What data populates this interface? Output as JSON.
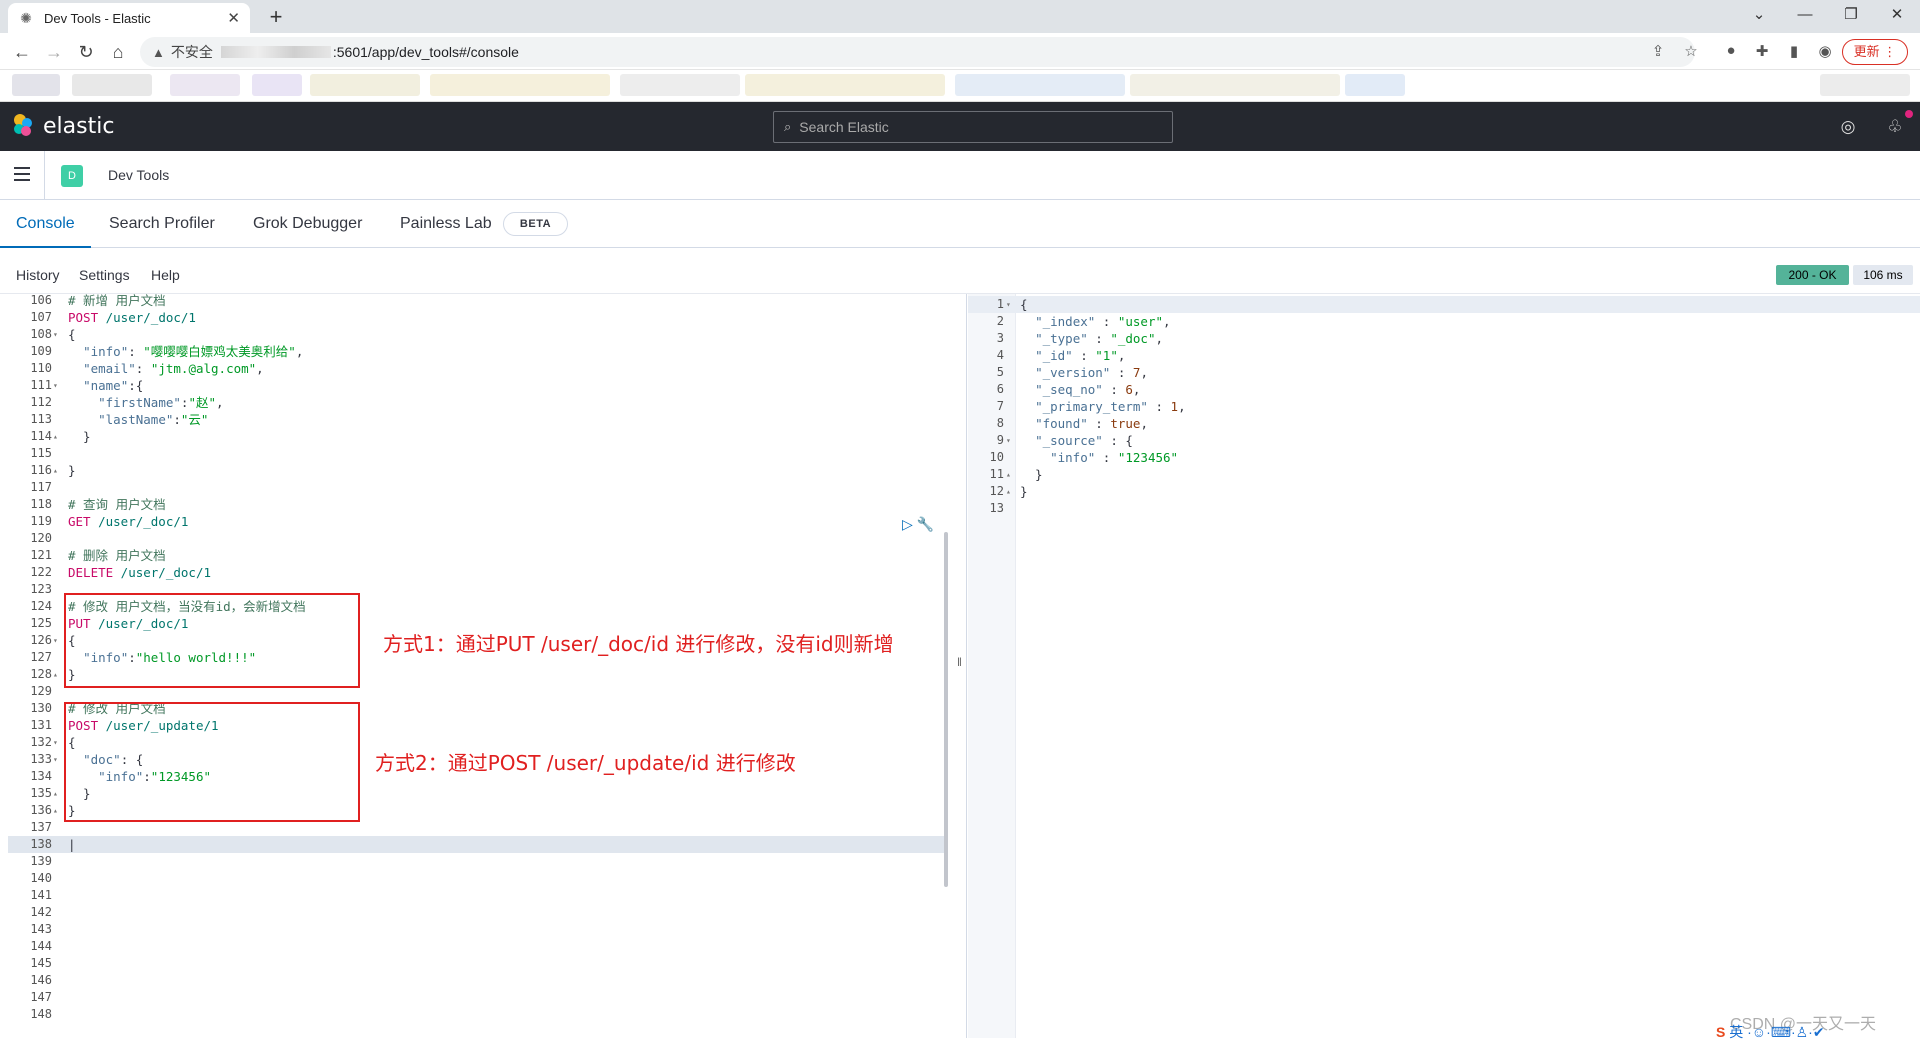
{
  "browser": {
    "tab_title": "Dev Tools - Elastic",
    "insecure_label": "不安全",
    "url_rest": ":5601/app/dev_tools#/console",
    "update_label": "更新"
  },
  "kibana": {
    "brand": "elastic",
    "search_placeholder": "Search Elastic",
    "avatar_letter": "D",
    "breadcrumb": "Dev Tools",
    "tabs": [
      "Console",
      "Search Profiler",
      "Grok Debugger",
      "Painless Lab"
    ],
    "beta_badge": "BETA",
    "menu": [
      "History",
      "Settings",
      "Help"
    ],
    "status": "200 - OK",
    "duration": "106 ms"
  },
  "editor_lines": [
    {
      "n": "106",
      "f": "",
      "t": [
        [
          "c-cm",
          "# 新增 用户文档"
        ]
      ]
    },
    {
      "n": "107",
      "f": "",
      "t": [
        [
          "c-m",
          "POST"
        ],
        [
          "c-u",
          " /user/_doc/1"
        ]
      ]
    },
    {
      "n": "108",
      "f": "▾",
      "t": [
        [
          "c-p",
          "{"
        ]
      ]
    },
    {
      "n": "109",
      "f": "",
      "t": [
        [
          "c-p",
          "  "
        ],
        [
          "c-k",
          "\"info\""
        ],
        [
          "c-p",
          ": "
        ],
        [
          "c-s",
          "\"嘤嘤嘤白嫖鸡太美奥利给\""
        ],
        [
          "c-p",
          ","
        ]
      ]
    },
    {
      "n": "110",
      "f": "",
      "t": [
        [
          "c-p",
          "  "
        ],
        [
          "c-k",
          "\"email\""
        ],
        [
          "c-p",
          ": "
        ],
        [
          "c-s",
          "\"jtm.@alg.com\""
        ],
        [
          "c-p",
          ","
        ]
      ]
    },
    {
      "n": "111",
      "f": "▾",
      "t": [
        [
          "c-p",
          "  "
        ],
        [
          "c-k",
          "\"name\""
        ],
        [
          "c-p",
          ":{"
        ]
      ]
    },
    {
      "n": "112",
      "f": "",
      "t": [
        [
          "c-p",
          "    "
        ],
        [
          "c-k",
          "\"firstName\""
        ],
        [
          "c-p",
          ":"
        ],
        [
          "c-s",
          "\"赵\""
        ],
        [
          "c-p",
          ","
        ]
      ]
    },
    {
      "n": "113",
      "f": "",
      "t": [
        [
          "c-p",
          "    "
        ],
        [
          "c-k",
          "\"lastName\""
        ],
        [
          "c-p",
          ":"
        ],
        [
          "c-s",
          "\"云\""
        ]
      ]
    },
    {
      "n": "114",
      "f": "▴",
      "t": [
        [
          "c-p",
          "  }"
        ]
      ]
    },
    {
      "n": "115",
      "f": "",
      "t": []
    },
    {
      "n": "116",
      "f": "▴",
      "t": [
        [
          "c-p",
          "}"
        ]
      ]
    },
    {
      "n": "117",
      "f": "",
      "t": []
    },
    {
      "n": "118",
      "f": "",
      "t": [
        [
          "c-cm",
          "# 查询 用户文档"
        ]
      ]
    },
    {
      "n": "119",
      "f": "",
      "t": [
        [
          "c-m",
          "GET"
        ],
        [
          "c-u",
          " /user/_doc/1"
        ]
      ]
    },
    {
      "n": "120",
      "f": "",
      "t": []
    },
    {
      "n": "121",
      "f": "",
      "t": [
        [
          "c-cm",
          "# 删除 用户文档"
        ]
      ]
    },
    {
      "n": "122",
      "f": "",
      "t": [
        [
          "c-m",
          "DELETE"
        ],
        [
          "c-u",
          " /user/_doc/1"
        ]
      ]
    },
    {
      "n": "123",
      "f": "",
      "t": []
    },
    {
      "n": "124",
      "f": "",
      "t": [
        [
          "c-cm",
          "# 修改 用户文档，当没有id，会新增文档"
        ]
      ]
    },
    {
      "n": "125",
      "f": "",
      "t": [
        [
          "c-m",
          "PUT"
        ],
        [
          "c-u",
          " /user/_doc/1"
        ]
      ]
    },
    {
      "n": "126",
      "f": "▾",
      "t": [
        [
          "c-p",
          "{"
        ]
      ]
    },
    {
      "n": "127",
      "f": "",
      "t": [
        [
          "c-p",
          "  "
        ],
        [
          "c-k",
          "\"info\""
        ],
        [
          "c-p",
          ":"
        ],
        [
          "c-s",
          "\"hello world!!!\""
        ]
      ]
    },
    {
      "n": "128",
      "f": "▴",
      "t": [
        [
          "c-p",
          "}"
        ]
      ]
    },
    {
      "n": "129",
      "f": "",
      "t": []
    },
    {
      "n": "130",
      "f": "",
      "t": [
        [
          "c-cm",
          "# 修改 用户文档"
        ]
      ]
    },
    {
      "n": "131",
      "f": "",
      "t": [
        [
          "c-m",
          "POST"
        ],
        [
          "c-u",
          " /user/_update/1"
        ]
      ]
    },
    {
      "n": "132",
      "f": "▾",
      "t": [
        [
          "c-p",
          "{"
        ]
      ]
    },
    {
      "n": "133",
      "f": "▾",
      "t": [
        [
          "c-p",
          "  "
        ],
        [
          "c-k",
          "\"doc\""
        ],
        [
          "c-p",
          ": {"
        ]
      ]
    },
    {
      "n": "134",
      "f": "",
      "t": [
        [
          "c-p",
          "    "
        ],
        [
          "c-k",
          "\"info\""
        ],
        [
          "c-p",
          ":"
        ],
        [
          "c-s",
          "\"123456\""
        ]
      ]
    },
    {
      "n": "135",
      "f": "▴",
      "t": [
        [
          "c-p",
          "  }"
        ]
      ]
    },
    {
      "n": "136",
      "f": "▴",
      "t": [
        [
          "c-p",
          "}"
        ]
      ]
    },
    {
      "n": "137",
      "f": "",
      "t": []
    },
    {
      "n": "138",
      "f": "",
      "t": [
        [
          "c-p",
          "|"
        ]
      ],
      "cur": true
    },
    {
      "n": "139",
      "f": "",
      "t": []
    },
    {
      "n": "140",
      "f": "",
      "t": []
    },
    {
      "n": "141",
      "f": "",
      "t": []
    },
    {
      "n": "142",
      "f": "",
      "t": []
    },
    {
      "n": "143",
      "f": "",
      "t": []
    },
    {
      "n": "144",
      "f": "",
      "t": []
    },
    {
      "n": "145",
      "f": "",
      "t": []
    },
    {
      "n": "146",
      "f": "",
      "t": []
    },
    {
      "n": "147",
      "f": "",
      "t": []
    },
    {
      "n": "148",
      "f": "",
      "t": []
    }
  ],
  "output_lines": [
    {
      "n": "1",
      "f": "▾",
      "t": [
        [
          "c-p",
          "{"
        ]
      ],
      "cur": true
    },
    {
      "n": "2",
      "f": "",
      "t": [
        [
          "c-p",
          "  "
        ],
        [
          "c-k",
          "\"_index\""
        ],
        [
          "c-p",
          " : "
        ],
        [
          "c-s",
          "\"user\""
        ],
        [
          "c-p",
          ","
        ]
      ]
    },
    {
      "n": "3",
      "f": "",
      "t": [
        [
          "c-p",
          "  "
        ],
        [
          "c-k",
          "\"_type\""
        ],
        [
          "c-p",
          " : "
        ],
        [
          "c-s",
          "\"_doc\""
        ],
        [
          "c-p",
          ","
        ]
      ]
    },
    {
      "n": "4",
      "f": "",
      "t": [
        [
          "c-p",
          "  "
        ],
        [
          "c-k",
          "\"_id\""
        ],
        [
          "c-p",
          " : "
        ],
        [
          "c-s",
          "\"1\""
        ],
        [
          "c-p",
          ","
        ]
      ]
    },
    {
      "n": "5",
      "f": "",
      "t": [
        [
          "c-p",
          "  "
        ],
        [
          "c-k",
          "\"_version\""
        ],
        [
          "c-p",
          " : "
        ],
        [
          "c-b",
          "7"
        ],
        [
          "c-p",
          ","
        ]
      ]
    },
    {
      "n": "6",
      "f": "",
      "t": [
        [
          "c-p",
          "  "
        ],
        [
          "c-k",
          "\"_seq_no\""
        ],
        [
          "c-p",
          " : "
        ],
        [
          "c-b",
          "6"
        ],
        [
          "c-p",
          ","
        ]
      ]
    },
    {
      "n": "7",
      "f": "",
      "t": [
        [
          "c-p",
          "  "
        ],
        [
          "c-k",
          "\"_primary_term\""
        ],
        [
          "c-p",
          " : "
        ],
        [
          "c-b",
          "1"
        ],
        [
          "c-p",
          ","
        ]
      ]
    },
    {
      "n": "8",
      "f": "",
      "t": [
        [
          "c-p",
          "  "
        ],
        [
          "c-k",
          "\"found\""
        ],
        [
          "c-p",
          " : "
        ],
        [
          "c-b",
          "true"
        ],
        [
          "c-p",
          ","
        ]
      ]
    },
    {
      "n": "9",
      "f": "▾",
      "t": [
        [
          "c-p",
          "  "
        ],
        [
          "c-k",
          "\"_source\""
        ],
        [
          "c-p",
          " : {"
        ]
      ]
    },
    {
      "n": "10",
      "f": "",
      "t": [
        [
          "c-p",
          "    "
        ],
        [
          "c-k",
          "\"info\""
        ],
        [
          "c-p",
          " : "
        ],
        [
          "c-s",
          "\"123456\""
        ]
      ]
    },
    {
      "n": "11",
      "f": "▴",
      "t": [
        [
          "c-p",
          "  }"
        ]
      ]
    },
    {
      "n": "12",
      "f": "▴",
      "t": [
        [
          "c-p",
          "}"
        ]
      ]
    },
    {
      "n": "13",
      "f": "",
      "t": []
    }
  ],
  "annotations": {
    "method1": "方式1：通过PUT /user/_doc/id 进行修改，没有id则新增",
    "method2": "方式2：通过POST /user/_update/id 进行修改"
  },
  "watermark": "CSDN @一天又一天",
  "ime_label": "英"
}
